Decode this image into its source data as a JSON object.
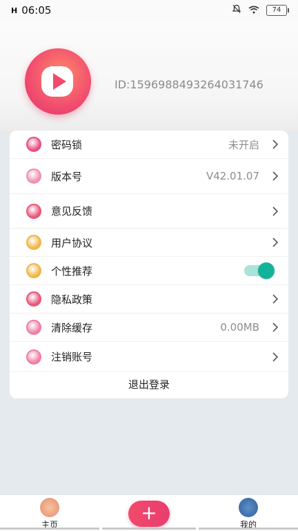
{
  "status_bar": {
    "signal": "H",
    "time": "06:05",
    "battery": "74"
  },
  "profile": {
    "id_text": "ID:1596988493264031746"
  },
  "settings": [
    {
      "label": "密码锁",
      "value": "未开启",
      "icon": "lock-icon",
      "color": "#e84f7f"
    },
    {
      "label": "版本号",
      "value": "V42.01.07",
      "icon": "calendar-icon",
      "color": "#f08fb2"
    },
    {
      "label": "意见反馈",
      "value": "",
      "icon": "feedback-icon",
      "color": "#e8567a"
    },
    {
      "label": "用户协议",
      "value": "",
      "icon": "padlock-icon",
      "color": "#f0b648"
    },
    {
      "label": "个性推荐",
      "value": "",
      "icon": "padlock-icon",
      "color": "#f0b648",
      "toggle": true
    },
    {
      "label": "隐私政策",
      "value": "",
      "icon": "feedback-icon",
      "color": "#e8567a"
    },
    {
      "label": "清除缓存",
      "value": "0.00MB",
      "icon": "broom-icon",
      "color": "#f07ea2"
    },
    {
      "label": "注销账号",
      "value": "",
      "icon": "person-icon",
      "color": "#f07ea2"
    }
  ],
  "logout_label": "退出登录",
  "tabs": {
    "home": "主页",
    "add": "+",
    "mine": "我的"
  }
}
